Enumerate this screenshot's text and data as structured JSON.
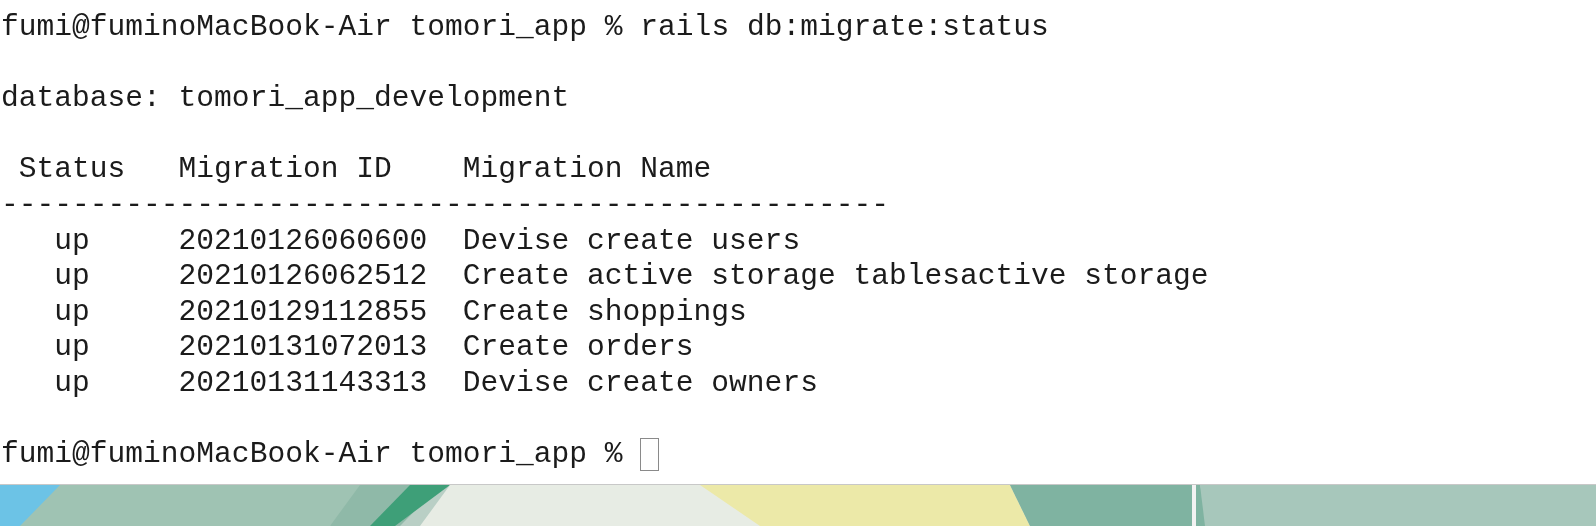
{
  "terminal": {
    "command_line": {
      "prompt": "fumi@fuminoMacBook-Air tomori_app %",
      "command": "rails db:migrate:status"
    },
    "database_line": "database: tomori_app_development",
    "table": {
      "columns": [
        "Status",
        "Migration ID",
        "Migration Name"
      ],
      "separator": "--------------------------------------------------",
      "rows": [
        {
          "status": "up",
          "id": "20210126060600",
          "name": "Devise create users"
        },
        {
          "status": "up",
          "id": "20210126062512",
          "name": "Create active storage tablesactive storage"
        },
        {
          "status": "up",
          "id": "20210129112855",
          "name": "Create shoppings"
        },
        {
          "status": "up",
          "id": "20210131072013",
          "name": "Create orders"
        },
        {
          "status": "up",
          "id": "20210131143313",
          "name": "Devise create owners"
        }
      ]
    },
    "prompt_line": {
      "prompt": "fumi@fuminoMacBook-Air tomori_app %"
    }
  }
}
